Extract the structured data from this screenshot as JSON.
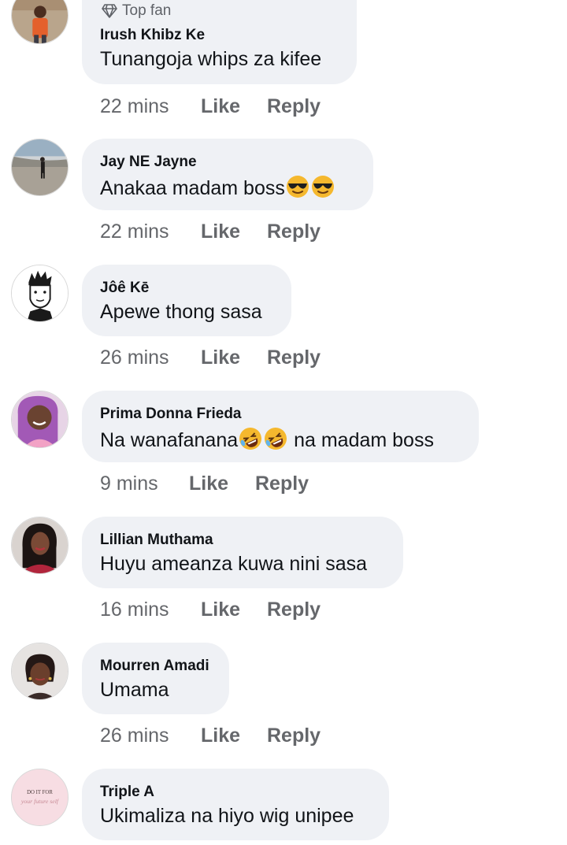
{
  "comments": [
    {
      "badge": "Top fan",
      "author": "Irush Khibz Ke",
      "text": "Tunangoja whips za kifee",
      "time": "22 mins",
      "like": "Like",
      "reply": "Reply"
    },
    {
      "author": "Jay NE Jayne",
      "text": "Anakaa madam boss",
      "emoji": [
        "smiling-face-with-sunglasses",
        "smiling-face-with-sunglasses"
      ],
      "time": "22 mins",
      "like": "Like",
      "reply": "Reply"
    },
    {
      "author": "Jôê Kē",
      "text": "Apewe thong sasa",
      "time": "26 mins",
      "like": "Like",
      "reply": "Reply"
    },
    {
      "author": "Prima Donna Frieda",
      "text_before": "Na wanafanana",
      "text_after": " na madam boss",
      "emoji": [
        "rolling-on-floor-laughing",
        "rolling-on-floor-laughing"
      ],
      "time": "9 mins",
      "like": "Like",
      "reply": "Reply"
    },
    {
      "author": "Lillian Muthama",
      "text": "Huyu ameanza kuwa nini sasa",
      "time": "16 mins",
      "like": "Like",
      "reply": "Reply"
    },
    {
      "author": "Mourren Amadi",
      "text": "Umama",
      "time": "26 mins",
      "like": "Like",
      "reply": "Reply"
    },
    {
      "author": "Triple A",
      "text": "Ukimaliza na hiyo wig unipee",
      "avatar_text_line1": "DO IT FOR",
      "avatar_text_line2": "your future self"
    }
  ],
  "colors": {
    "bubble": "#eff1f5",
    "text": "#111418",
    "meta": "#65676b"
  }
}
